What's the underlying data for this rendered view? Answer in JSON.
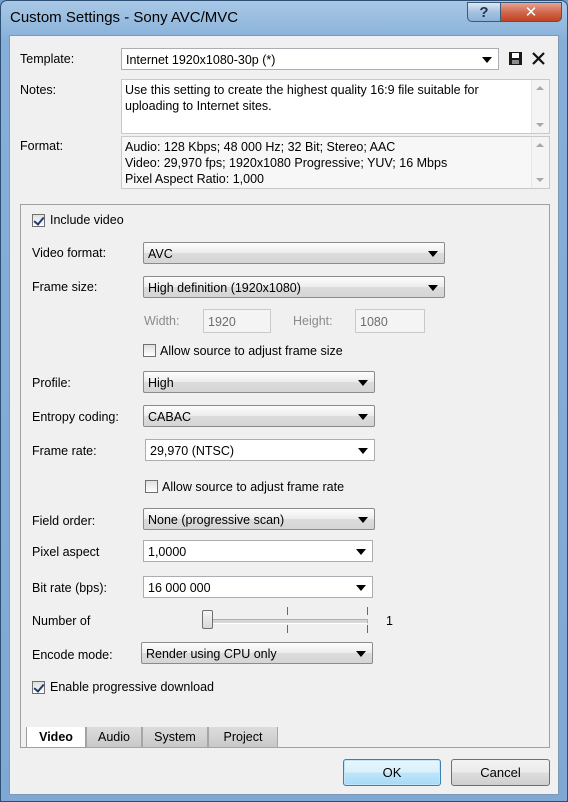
{
  "window": {
    "title": "Custom Settings - Sony AVC/MVC",
    "help_glyph": "?",
    "close_glyph": "✕"
  },
  "template": {
    "label": "Template:",
    "value": "Internet 1920x1080-30p (*)"
  },
  "notes": {
    "label": "Notes:",
    "text": "Use this setting to create the highest quality 16:9 file suitable for uploading to Internet sites."
  },
  "format": {
    "label": "Format:",
    "lines": [
      "Audio: 128 Kbps; 48 000 Hz; 32 Bit; Stereo; AAC",
      "Video: 29,970 fps; 1920x1080 Progressive; YUV; 16 Mbps",
      "Pixel Aspect Ratio: 1,000"
    ]
  },
  "video": {
    "include_video": {
      "label": "Include video",
      "checked": true
    },
    "video_format": {
      "label": "Video format:",
      "value": "AVC"
    },
    "frame_size": {
      "label": "Frame size:",
      "value": "High definition (1920x1080)"
    },
    "width": {
      "label": "Width:",
      "value": "1920"
    },
    "height": {
      "label": "Height:",
      "value": "1080"
    },
    "allow_frame_size": {
      "label": "Allow source to adjust frame size",
      "checked": false
    },
    "profile": {
      "label": "Profile:",
      "value": "High"
    },
    "entropy": {
      "label": "Entropy coding:",
      "value": "CABAC"
    },
    "frame_rate": {
      "label": "Frame rate:",
      "value": "29,970 (NTSC)"
    },
    "allow_frame_rate": {
      "label": "Allow source to adjust frame rate",
      "checked": false
    },
    "field_order": {
      "label": "Field order:",
      "value": "None (progressive scan)"
    },
    "pixel_aspect": {
      "label": "Pixel aspect",
      "value": "1,0000"
    },
    "bit_rate": {
      "label": "Bit rate (bps):",
      "value": "16 000 000"
    },
    "number_of": {
      "label": "Number of",
      "value": "1"
    },
    "encode_mode": {
      "label": "Encode mode:",
      "value": "Render using CPU only"
    },
    "progressive_download": {
      "label": "Enable progressive download",
      "checked": true
    }
  },
  "tabs": [
    {
      "label": "Video",
      "active": true
    },
    {
      "label": "Audio",
      "active": false
    },
    {
      "label": "System",
      "active": false
    },
    {
      "label": "Project",
      "active": false
    }
  ],
  "buttons": {
    "ok": "OK",
    "cancel": "Cancel"
  }
}
